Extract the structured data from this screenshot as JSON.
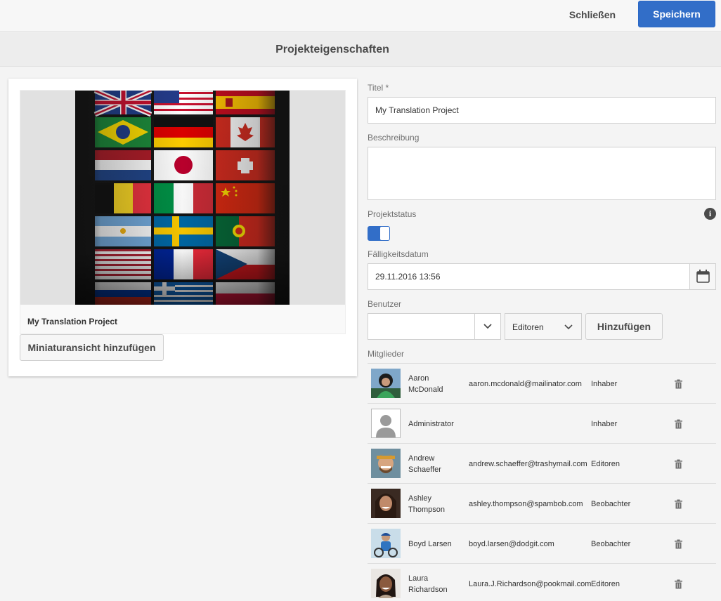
{
  "toolbar": {
    "close_label": "Schließen",
    "save_label": "Speichern"
  },
  "page": {
    "title": "Projekteigenschaften"
  },
  "thumbnail": {
    "project_name": "My Translation Project",
    "add_thumbnail_label": "Miniaturansicht hinzufügen",
    "image_subject": "grid of national flags"
  },
  "form": {
    "title_label": "Titel *",
    "title_value": "My Translation Project",
    "description_label": "Beschreibung",
    "description_value": "",
    "status_label": "Projektstatus",
    "status_on": true,
    "due_label": "Fälligkeitsdatum",
    "due_value": "29.11.2016 13:56",
    "users_label": "Benutzer",
    "user_value": "",
    "role_selected": "Editoren",
    "add_label": "Hinzufügen",
    "members_label": "Mitglieder"
  },
  "members": [
    {
      "name": "Aaron McDonald",
      "email": "aaron.mcdonald@mailinator.com",
      "role": "Inhaber",
      "avatar": "photo"
    },
    {
      "name": "Administrator",
      "email": "",
      "role": "Inhaber",
      "avatar": "placeholder"
    },
    {
      "name": "Andrew Schaeffer",
      "email": "andrew.schaeffer@trashymail.com",
      "role": "Editoren",
      "avatar": "photo"
    },
    {
      "name": "Ashley Thompson",
      "email": "ashley.thompson@spambob.com",
      "role": "Beobachter",
      "avatar": "photo"
    },
    {
      "name": "Boyd Larsen",
      "email": "boyd.larsen@dodgit.com",
      "role": "Beobachter",
      "avatar": "photo"
    },
    {
      "name": "Laura Richardson",
      "email": "Laura.J.Richardson@pookmail.com",
      "role": "Editoren",
      "avatar": "photo"
    }
  ],
  "colors": {
    "accent": "#326ec8",
    "background": "#f4f4f4",
    "card": "#ffffff"
  },
  "icons": {
    "info": "info-icon",
    "calendar": "calendar-icon",
    "dropdown": "chevron-down-icon",
    "delete": "trash-icon"
  }
}
